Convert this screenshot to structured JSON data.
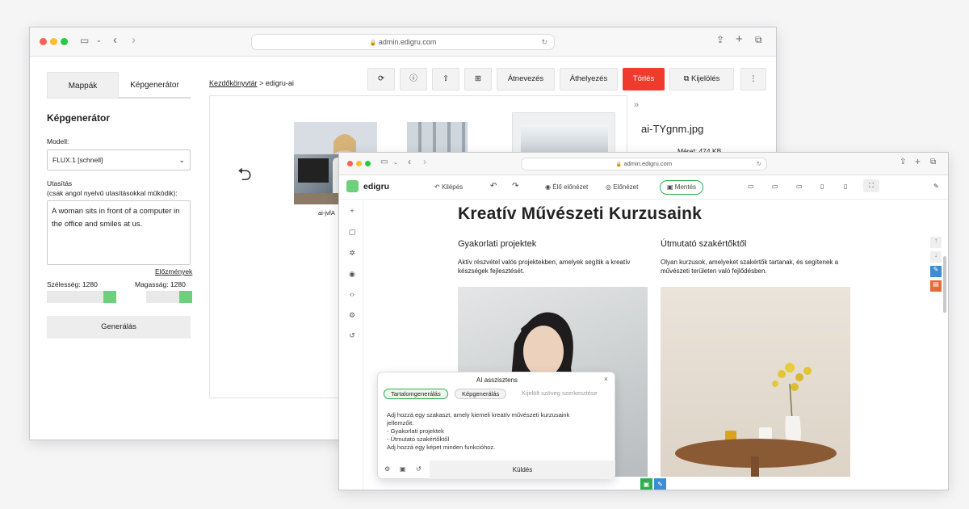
{
  "back_window": {
    "url": "admin.edigru.com",
    "tabs": [
      "Mappák",
      "Képgenerátor"
    ],
    "panel_title": "Képgenerátor",
    "model_label": "Modell:",
    "model_value": "FLUX.1 [schnell]",
    "prompt_label": "Utasítás",
    "prompt_hint": "(csak angol nyelvű utasításokkal működik):",
    "prompt_value": "A woman sits in front of a computer in the office and smiles at us.",
    "history_link": "Előzmények",
    "width_label": "Szélesség: 1280",
    "height_label": "Magasság: 1280",
    "generate_button": "Generálás",
    "breadcrumb_root": "Kezdőkönyvtár",
    "breadcrumb_sep": ">",
    "breadcrumb_current": "edigru-ai",
    "toolbar": {
      "rename": "Átnevezés",
      "move": "Áthelyezés",
      "delete": "Törlés",
      "select": "Kijelölés"
    },
    "thumb_caption": "ai-jvfA",
    "detail_filename": "ai-TYgnm.jpg",
    "detail_size": "Méret: 474 KB",
    "collapse_glyph": "»"
  },
  "front_window": {
    "url": "admin.edigru.com",
    "brand": "edigru",
    "toolbar": {
      "exit": "Kilépés",
      "live_preview": "Élő előnézet",
      "preview": "Előnézet",
      "save": "Mentés"
    },
    "heading": "Kreatív Művészeti Kurzusaink",
    "col1_title": "Gyakorlati projektek",
    "col1_text": "Aktív részvétel valós projektekben, amelyek segítik a kreatív készségek fejlesztését.",
    "col2_title": "Útmutató szakértőktől",
    "col2_text": "Olyan kurzusok, amelyeket szakértők tartanak, és segítenek a művészeti területen való fejlődésben."
  },
  "ai_assistant": {
    "title": "AI asszisztens",
    "tabs": [
      "Tartalomgenerálás",
      "Képgenerálás",
      "Kijelölt szöveg szerkesztése"
    ],
    "prompt_lines": [
      "Adj hozzá egy szakaszt, amely kiemeli kreatív művészeti kurzusaink",
      "jellemzőit:",
      "- Gyakorlati projektek",
      "- Útmutató szakértőktől",
      "Adj hozzá egy képet minden funkcióhoz."
    ],
    "send": "Küldés"
  },
  "colors": {
    "delete": "#ef3b2c",
    "accent_green": "#6cd07c",
    "edit_blue": "#3c8dd6",
    "trash_orange": "#e8693a",
    "save_green": "#2eae4e"
  }
}
